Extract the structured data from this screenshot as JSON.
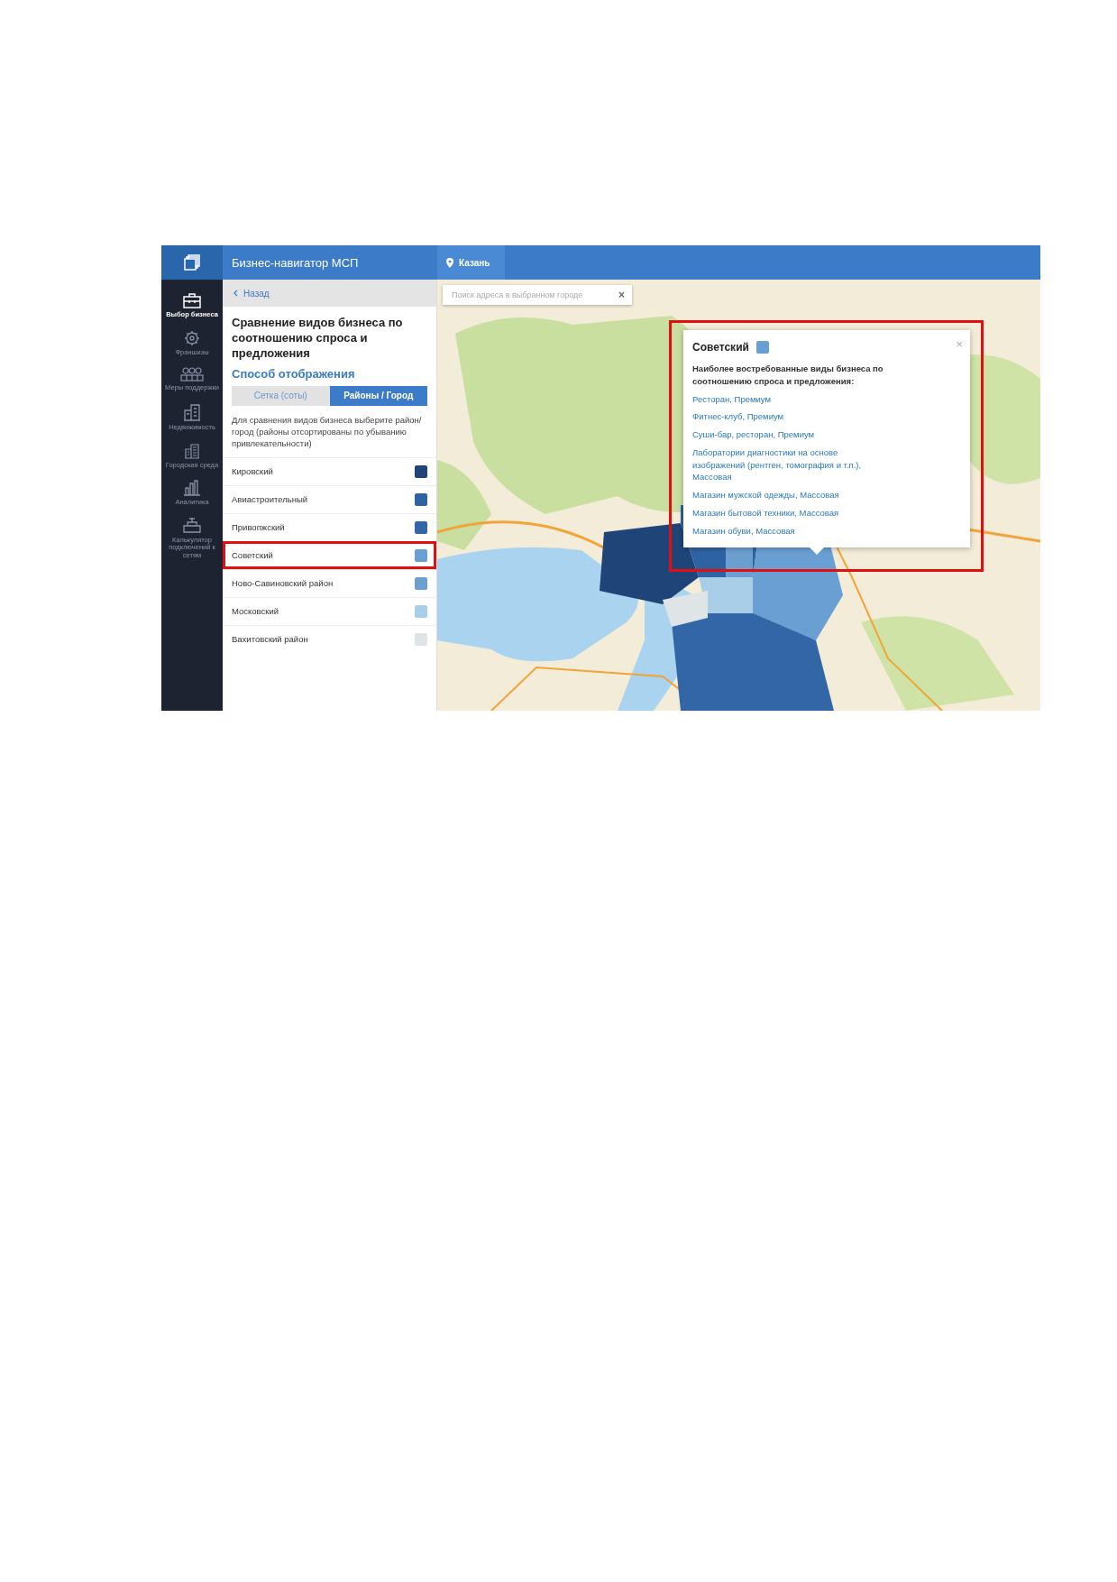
{
  "header": {
    "title": "Бизнес-навигатор МСП",
    "city": "Казань"
  },
  "rail": [
    {
      "label": "Выбор бизнеса",
      "kind": "briefcase",
      "selected": true
    },
    {
      "label": "Франшизы",
      "kind": "gear",
      "selected": false
    },
    {
      "label": "Меры поддержки",
      "kind": "people",
      "selected": false
    },
    {
      "label": "Недвижимость",
      "kind": "building",
      "selected": false
    },
    {
      "label": "Городская среда",
      "kind": "city",
      "selected": false
    },
    {
      "label": "Аналитика",
      "kind": "chart",
      "selected": false
    },
    {
      "label": "Калькулятор подключений к сетям",
      "kind": "pipe",
      "selected": false
    }
  ],
  "panel": {
    "back": "Назад",
    "title": "Сравнение видов бизнеса по соотношению спроса и предложения",
    "subtitle": "Способ отображения",
    "tabs": [
      {
        "label": "Сетка (соты)",
        "selected": false
      },
      {
        "label": "Районы / Город",
        "selected": true
      }
    ],
    "hint": "Для сравнения видов бизнеса выберите район/город (районы отсортированы по убыванию привлекательности)",
    "districts": [
      {
        "name": "Кировский",
        "color": "#1f4477",
        "highlighted": false
      },
      {
        "name": "Авиастроительный",
        "color": "#2e63a3",
        "highlighted": false
      },
      {
        "name": "Привопжский",
        "color": "#3366a6",
        "highlighted": false
      },
      {
        "name": "Советский",
        "color": "#6a9fd3",
        "highlighted": true
      },
      {
        "name": "Ново-Савиновский район",
        "color": "#6c9fd0",
        "highlighted": false
      },
      {
        "name": "Московский",
        "color": "#a9cfe8",
        "highlighted": false
      },
      {
        "name": "Вахитовский район",
        "color": "#dfe4e6",
        "highlighted": false
      }
    ]
  },
  "search": {
    "placeholder": "Поиск адреса в выбранном городе",
    "clear": "×"
  },
  "popup": {
    "title": "Советский",
    "color": "#6a9fd3",
    "close": "×",
    "highlighted": true,
    "heading": "Наиболее востребованные виды бизнеса по соотношению спроса и предложения:",
    "links": [
      "Ресторан, Премиум",
      "Фитнес-клуб, Премиум",
      "Суши-бар, ресторан, Премиум",
      "Лаборатории диагностики на основе изображений (рентген, томография и т.п.), Массовая",
      "Магазин мужской одежды, Массовая",
      "Магазин бытовой техники, Массовая",
      "Магазин обуви, Массовая"
    ]
  }
}
